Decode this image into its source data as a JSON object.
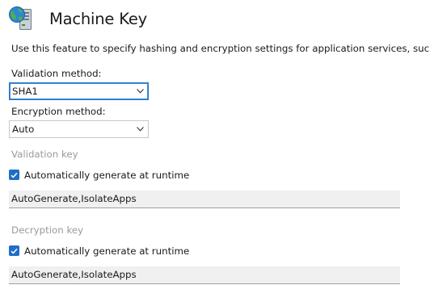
{
  "header": {
    "title": "Machine Key",
    "icon": "server-globe-icon"
  },
  "description": "Use this feature to specify hashing and encryption settings for application services, such as view sta",
  "validation_method": {
    "label": "Validation method:",
    "value": "SHA1"
  },
  "encryption_method": {
    "label": "Encryption method:",
    "value": "Auto"
  },
  "validation_key": {
    "label": "Validation key",
    "auto_generate": {
      "label": "Automatically generate at runtime",
      "checked": true
    },
    "value": "AutoGenerate,IsolateApps"
  },
  "decryption_key": {
    "label": "Decryption key",
    "auto_generate": {
      "label": "Automatically generate at runtime",
      "checked": true
    },
    "value": "AutoGenerate,IsolateApps"
  },
  "colors": {
    "accent": "#1f6fc6",
    "disabled_text": "#9a9a9a",
    "field_background": "#f0f0f0"
  }
}
